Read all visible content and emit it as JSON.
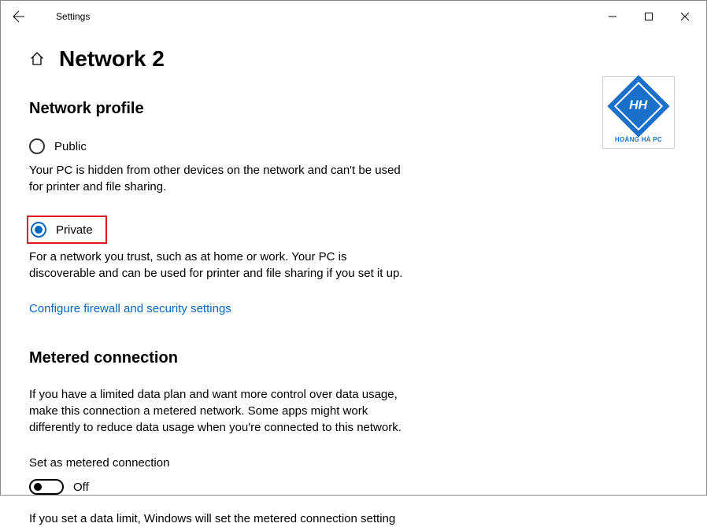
{
  "window": {
    "app_name": "Settings"
  },
  "page": {
    "title": "Network 2"
  },
  "profile": {
    "heading": "Network profile",
    "public": {
      "label": "Public",
      "description": "Your PC is hidden from other devices on the network and can't be used for printer and file sharing."
    },
    "private": {
      "label": "Private",
      "description": "For a network you trust, such as at home or work. Your PC is discoverable and can be used for printer and file sharing if you set it up."
    },
    "link": "Configure firewall and security settings"
  },
  "metered": {
    "heading": "Metered connection",
    "description": "If you have a limited data plan and want more control over data usage, make this connection a metered network. Some apps might work differently to reduce data usage when you're connected to this network.",
    "toggle_label": "Set as metered connection",
    "toggle_status": "Off",
    "datalimit_text": "If you set a data limit, Windows will set the metered connection setting"
  },
  "logo": {
    "text": "HH",
    "caption": "HOÀNG HÀ PC"
  }
}
